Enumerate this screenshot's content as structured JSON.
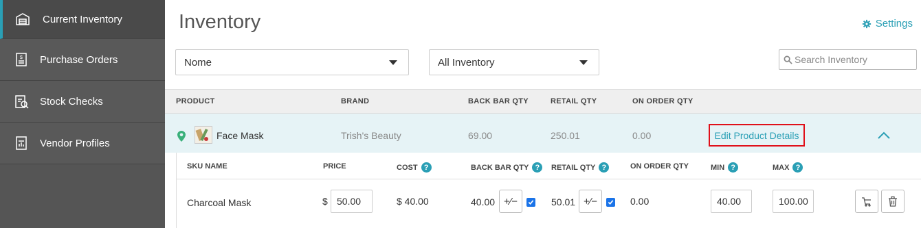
{
  "sidebar": {
    "items": [
      {
        "label": "Current Inventory",
        "icon": "warehouse-icon",
        "active": true
      },
      {
        "label": "Purchase Orders",
        "icon": "purchase-order-icon",
        "active": false
      },
      {
        "label": "Stock Checks",
        "icon": "stock-check-icon",
        "active": false
      },
      {
        "label": "Vendor Profiles",
        "icon": "vendor-profile-icon",
        "active": false
      }
    ]
  },
  "header": {
    "title": "Inventory",
    "settings_label": "Settings"
  },
  "filters": {
    "vendor_selected": "Nome",
    "inventory_selected": "All Inventory",
    "search_placeholder": "Search Inventory",
    "search_value": ""
  },
  "table": {
    "columns": [
      "PRODUCT",
      "BRAND",
      "BACK BAR QTY",
      "RETAIL QTY",
      "ON ORDER QTY"
    ],
    "product": {
      "name": "Face Mask",
      "brand": "Trish's Beauty",
      "back_bar_qty": "69.00",
      "retail_qty": "250.01",
      "on_order_qty": "0.00",
      "edit_label": "Edit Product Details"
    }
  },
  "sku_table": {
    "columns": {
      "sku_name": "SKU NAME",
      "price": "PRICE",
      "cost": "COST",
      "back_bar_qty": "BACK BAR QTY",
      "retail_qty": "RETAIL QTY",
      "on_order_qty": "ON ORDER QTY",
      "min": "MIN",
      "max": "MAX"
    },
    "help_glyph": "?",
    "adjust_glyph": "+⁄−",
    "currency": "$",
    "row": {
      "sku_name": "Charcoal Mask",
      "price": "50.00",
      "cost": "$ 40.00",
      "back_bar_qty": "40.00",
      "back_bar_checked": true,
      "retail_qty": "50.01",
      "retail_checked": true,
      "on_order_qty": "0.00",
      "min": "40.00",
      "max": "100.00"
    }
  },
  "colors": {
    "accent": "#2a9fb5",
    "sidebar_bg": "#555555",
    "highlight_border": "#e0101a",
    "product_row_bg": "#e6f3f6"
  }
}
